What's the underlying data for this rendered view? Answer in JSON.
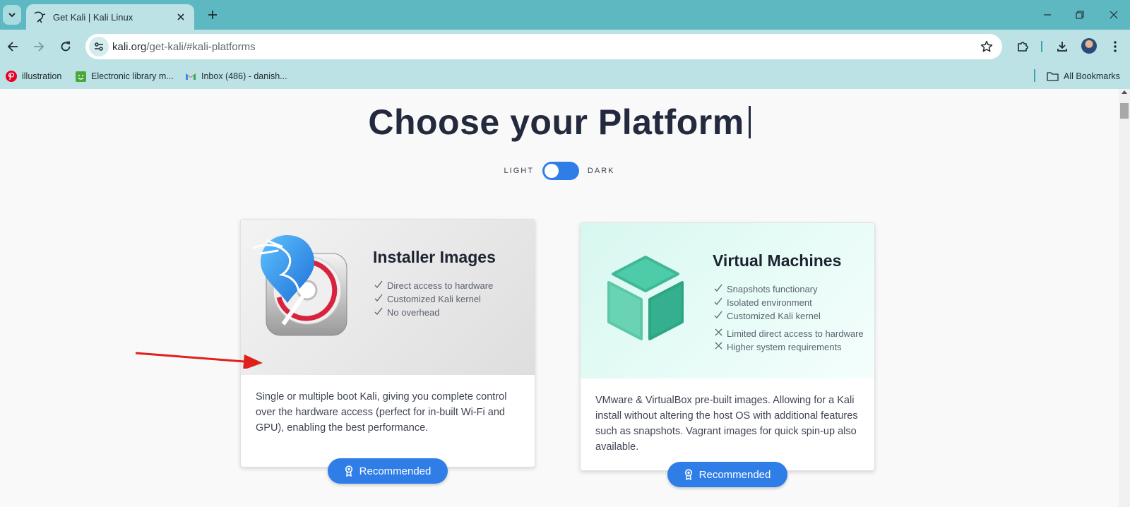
{
  "browser": {
    "tab_title": "Get Kali | Kali Linux",
    "url_host": "kali.org",
    "url_path": "/get-kali/#kali-platforms",
    "bookmarks": [
      {
        "label": "illustration",
        "icon": "pinterest-icon"
      },
      {
        "label": "Electronic library m...",
        "icon": "library-icon"
      },
      {
        "label": "Inbox (486) - danish...",
        "icon": "gmail-icon"
      }
    ],
    "all_bookmarks_label": "All Bookmarks"
  },
  "page": {
    "heading_pre": "Choose ",
    "heading_bold": "your",
    "heading_post": " Platform",
    "toggle_light": "LIGHT",
    "toggle_dark": "DARK",
    "cards": [
      {
        "title": "Installer Images",
        "features": [
          {
            "mark": "check",
            "text": "Direct access to hardware"
          },
          {
            "mark": "check",
            "text": "Customized Kali kernel"
          },
          {
            "mark": "check",
            "text": "No overhead"
          }
        ],
        "description": "Single or multiple boot Kali, giving you complete control over the hardware access (perfect for in-built Wi-Fi and GPU), enabling the best performance.",
        "button": "Recommended"
      },
      {
        "title": "Virtual Machines",
        "features": [
          {
            "mark": "check",
            "text": "Snapshots functionary"
          },
          {
            "mark": "check",
            "text": "Isolated environment"
          },
          {
            "mark": "check",
            "text": "Customized Kali kernel"
          },
          {
            "mark": "cross",
            "text": "Limited direct access to hardware"
          },
          {
            "mark": "cross",
            "text": "Higher system requirements"
          }
        ],
        "description": "VMware & VirtualBox pre-built images. Allowing for a Kali install without altering the host OS with additional features such as snapshots. Vagrant images for quick spin-up also available.",
        "button": "Recommended"
      }
    ]
  },
  "colors": {
    "tabbar": "#5db8c1",
    "toolbar": "#bce2e6",
    "accent_blue": "#2f7ee8",
    "annotation_arrow": "#e0201c"
  }
}
